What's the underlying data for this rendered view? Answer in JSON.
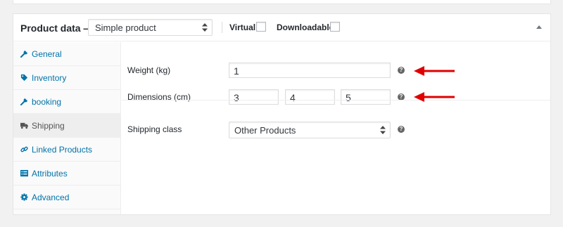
{
  "header": {
    "title": "Product data —",
    "product_type": "Simple product",
    "virtual_label": "Virtual:",
    "downloadable_label": "Downloadable:"
  },
  "tabs": [
    {
      "label": "General",
      "icon": "wrench-icon"
    },
    {
      "label": "Inventory",
      "icon": "tag-icon"
    },
    {
      "label": "booking",
      "icon": "wrench-icon"
    },
    {
      "label": "Shipping",
      "icon": "truck-icon",
      "active": true
    },
    {
      "label": "Linked Products",
      "icon": "link-icon"
    },
    {
      "label": "Attributes",
      "icon": "list-icon"
    },
    {
      "label": "Advanced",
      "icon": "gear-icon"
    }
  ],
  "shipping": {
    "weight_label": "Weight (kg)",
    "weight_value": "1",
    "dimensions_label": "Dimensions (cm)",
    "length": "3",
    "width": "4",
    "height": "5",
    "shipping_class_label": "Shipping class",
    "shipping_class_value": "Other Products",
    "help_glyph": "?"
  },
  "colors": {
    "link": "#0073aa",
    "annotation_arrow": "#e00000",
    "active_tab_bg": "#eeeeee"
  }
}
